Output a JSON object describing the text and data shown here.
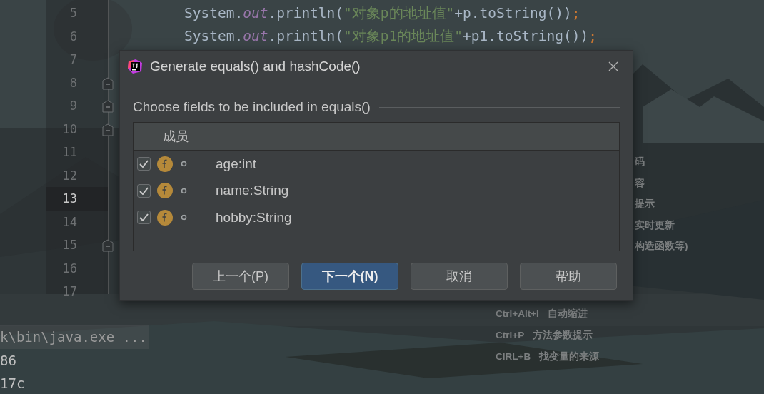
{
  "editor": {
    "lines": [
      {
        "number": "5",
        "current": false,
        "fold": false,
        "tokens": [
          {
            "kind": "plain",
            "text": "System."
          },
          {
            "kind": "field",
            "text": "out"
          },
          {
            "kind": "plain",
            "text": ".println("
          },
          {
            "kind": "string",
            "text": "\"对象p的地址值\""
          },
          {
            "kind": "plain",
            "text": "+p.toString())"
          },
          {
            "kind": "punct",
            "text": ";"
          }
        ]
      },
      {
        "number": "6",
        "current": false,
        "fold": false,
        "tokens": [
          {
            "kind": "plain",
            "text": "System."
          },
          {
            "kind": "field",
            "text": "out"
          },
          {
            "kind": "plain",
            "text": ".println("
          },
          {
            "kind": "string",
            "text": "\"对象p1的地址值\""
          },
          {
            "kind": "plain",
            "text": "+p1.toString())"
          },
          {
            "kind": "punct",
            "text": ";"
          }
        ]
      },
      {
        "number": "7",
        "current": false,
        "fold": false
      },
      {
        "number": "8",
        "current": false,
        "fold": true
      },
      {
        "number": "9",
        "current": false,
        "fold": true
      },
      {
        "number": "10",
        "current": false,
        "fold": true
      },
      {
        "number": "11",
        "current": false,
        "fold": false
      },
      {
        "number": "12",
        "current": false,
        "fold": false
      },
      {
        "number": "13",
        "current": true,
        "fold": false
      },
      {
        "number": "14",
        "current": false,
        "fold": false
      },
      {
        "number": "15",
        "current": false,
        "fold": true
      },
      {
        "number": "16",
        "current": false,
        "fold": false
      },
      {
        "number": "17",
        "current": false,
        "fold": false
      }
    ]
  },
  "console": {
    "lines": [
      "k\\bin\\java.exe ...",
      "86",
      "17c"
    ]
  },
  "hints_right": [
    "码",
    "容",
    "提示",
    "实时更新",
    "构造函数等)"
  ],
  "hints_bottom": [
    {
      "keys": "Ctrl+Alt+I",
      "action": "自动缩进"
    },
    {
      "keys": "Ctrl+P",
      "action": "方法参数提示"
    },
    {
      "keys": "CIRL+B",
      "action": "找变量的来源"
    }
  ],
  "dialog": {
    "title": "Generate equals() and hashCode()",
    "section_label": "Choose fields to be included in equals()",
    "table": {
      "columns": [
        "成员"
      ],
      "rows": [
        {
          "checked": true,
          "name": "age:int"
        },
        {
          "checked": true,
          "name": "name:String"
        },
        {
          "checked": true,
          "name": "hobby:String"
        }
      ]
    },
    "buttons": [
      {
        "label": "上一个(P)",
        "default": false
      },
      {
        "label": "下一个(N)",
        "default": true
      },
      {
        "label": "取消",
        "default": false
      },
      {
        "label": "帮助",
        "default": false
      }
    ]
  }
}
